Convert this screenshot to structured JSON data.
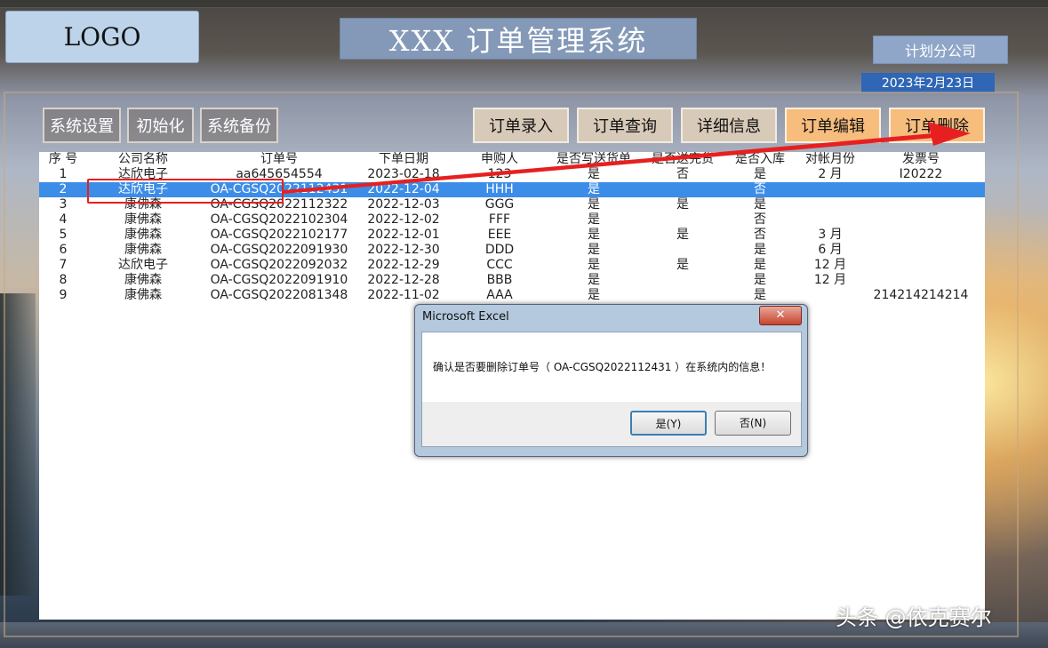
{
  "header": {
    "logo": "LOGO",
    "title": "XXX 订单管理系统",
    "company": "计划分公司",
    "date": "2023年2月23日"
  },
  "toolbar": {
    "left": [
      "系统设置",
      "初始化",
      "系统备份"
    ],
    "right": [
      "订单录入",
      "订单查询",
      "详细信息",
      "订单编辑",
      "订单删除"
    ]
  },
  "table": {
    "headers": [
      "序 号",
      "公司名称",
      "订单号",
      "下单日期",
      "申购人",
      "是否写送货单",
      "是否送完货",
      "是否入库",
      "对帐月份",
      "发票号"
    ],
    "rows": [
      [
        "1",
        "达欣电子",
        "aa645654554",
        "2023-02-18",
        "123",
        "是",
        "否",
        "是",
        "2 月",
        "I20222"
      ],
      [
        "2",
        "达欣电子",
        "OA-CGSQ2022112431",
        "2022-12-04",
        "HHH",
        "是",
        "",
        "否",
        "",
        ""
      ],
      [
        "3",
        "康佛森",
        "OA-CGSQ2022112322",
        "2022-12-03",
        "GGG",
        "是",
        "是",
        "是",
        "",
        ""
      ],
      [
        "4",
        "康佛森",
        "OA-CGSQ2022102304",
        "2022-12-02",
        "FFF",
        "是",
        "",
        "否",
        "",
        ""
      ],
      [
        "5",
        "康佛森",
        "OA-CGSQ2022102177",
        "2022-12-01",
        "EEE",
        "是",
        "是",
        "否",
        "3 月",
        ""
      ],
      [
        "6",
        "康佛森",
        "OA-CGSQ2022091930",
        "2022-12-30",
        "DDD",
        "是",
        "",
        "是",
        "6 月",
        ""
      ],
      [
        "7",
        "达欣电子",
        "OA-CGSQ2022092032",
        "2022-12-29",
        "CCC",
        "是",
        "是",
        "是",
        "12 月",
        ""
      ],
      [
        "8",
        "康佛森",
        "OA-CGSQ2022091910",
        "2022-12-28",
        "BBB",
        "是",
        "",
        "是",
        "12 月",
        ""
      ],
      [
        "9",
        "康佛森",
        "OA-CGSQ2022081348",
        "2022-11-02",
        "AAA",
        "是",
        "",
        "是",
        "",
        "214214214214"
      ]
    ],
    "selected_row": 1
  },
  "dialog": {
    "title": "Microsoft Excel",
    "close": "✕",
    "message": "确认是否要删除订单号（  OA-CGSQ2022112431  ）在系统内的信息！",
    "yes": "是(Y)",
    "no": "否(N)"
  },
  "watermark": "头条 @依克赛尔",
  "colors": {
    "selected_row": "#3c8de8",
    "annotation": "#e62020",
    "action_button": "#f7bd7d"
  }
}
